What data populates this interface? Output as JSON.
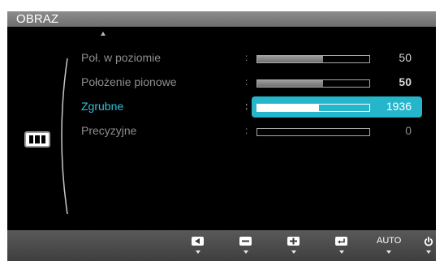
{
  "window": {
    "title": "OBRAZ"
  },
  "menu": {
    "section_icon": "picture-icon",
    "rows": [
      {
        "label": "Poł. w poziomie",
        "value": "50",
        "progress": 0.59,
        "state": "normal"
      },
      {
        "label": "Położenie pionowe",
        "value": "50",
        "progress": 0.59,
        "state": "normal-bold"
      },
      {
        "label": "Zgrubne",
        "value": "1936",
        "progress": 0.55,
        "state": "selected"
      },
      {
        "label": "Precyzyjne",
        "value": "0",
        "progress": 0,
        "state": "disabled"
      }
    ],
    "separator": ":"
  },
  "buttons": {
    "left_icon": "left-arrow-icon",
    "minus_icon": "minus-icon",
    "plus_icon": "plus-icon",
    "enter_icon": "enter-icon",
    "auto_label": "AUTO",
    "power_icon": "power-icon"
  },
  "colors": {
    "accent": "#26b6cc",
    "selected_label": "#2ec3dd",
    "bar_fill": "#8a8a8a"
  }
}
